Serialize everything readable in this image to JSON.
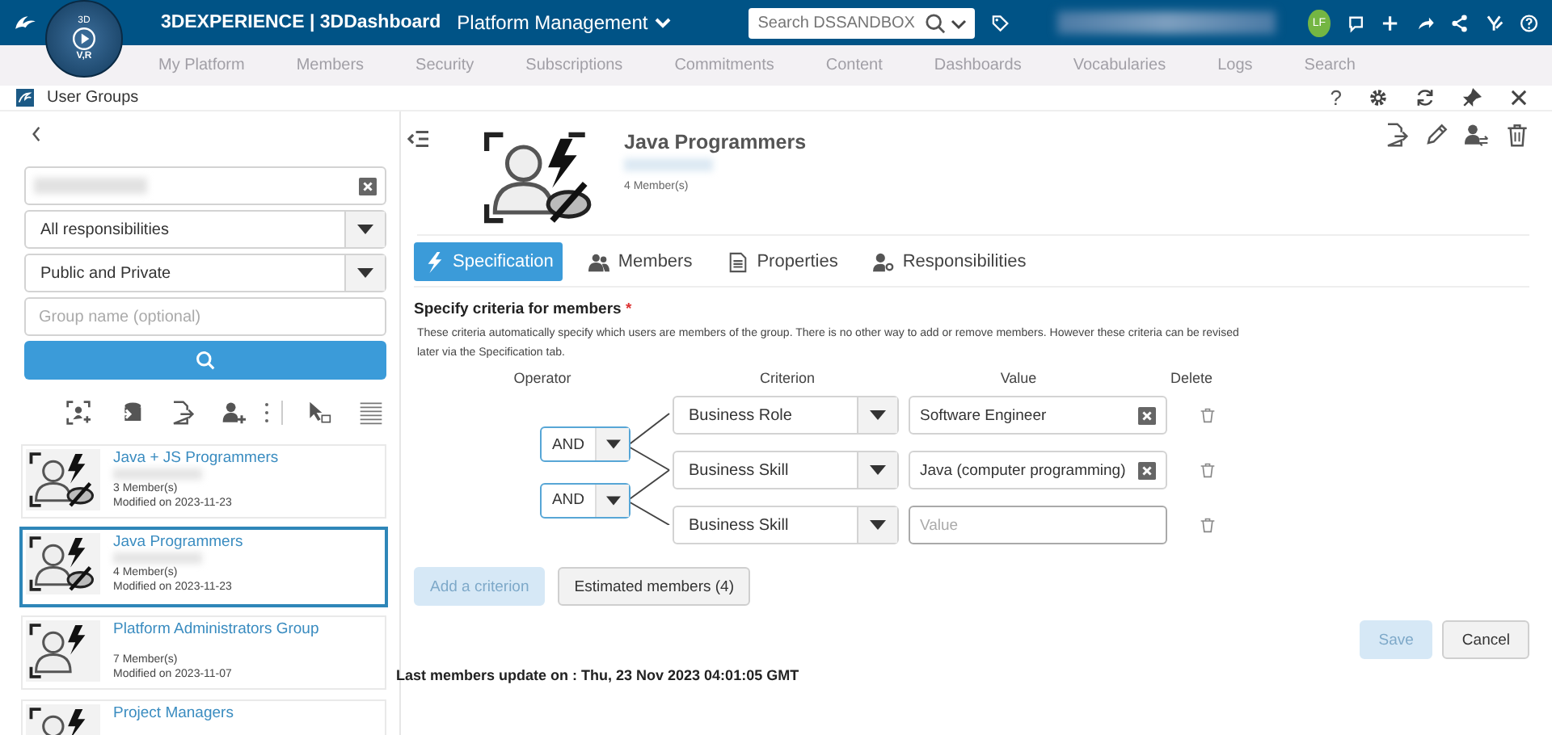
{
  "top_bar": {
    "brand": "3DEXPERIENCE | 3DDashboard",
    "dashboard": "Platform Management",
    "search": {
      "placeholder": "Search DSSANDBOX"
    },
    "compass": {
      "top": "3D",
      "bottom": "V,R"
    },
    "user_initials": "LF"
  },
  "nav_items": [
    "My Platform",
    "Members",
    "Security",
    "Subscriptions",
    "Commitments",
    "Content",
    "Dashboards",
    "Vocabularies",
    "Logs",
    "Search"
  ],
  "window": {
    "title": "User Groups",
    "help": "?"
  },
  "filters": {
    "selects": [
      "All responsibilities",
      "Public and Private"
    ],
    "group_name": {
      "placeholder": "Group name (optional)"
    }
  },
  "groups": [
    {
      "name": "Java + JS Programmers",
      "members": "3 Member(s)",
      "modified": "Modified on 2023-11-23",
      "private": true,
      "selected": false
    },
    {
      "name": "Java Programmers",
      "members": "4 Member(s)",
      "modified": "Modified on 2023-11-23",
      "private": true,
      "selected": true
    },
    {
      "name": "Platform Administrators Group",
      "members": "7 Member(s)",
      "modified": "Modified on 2023-11-07",
      "private": false,
      "selected": false
    },
    {
      "name": "Project Managers",
      "private": false,
      "selected": false
    }
  ],
  "detail": {
    "name": "Java Programmers",
    "members": "4 Member(s)",
    "private": true,
    "tabs": [
      {
        "label": "Specification",
        "kind": "bolt",
        "selected": true
      },
      {
        "label": "Members",
        "kind": "people",
        "selected": false
      },
      {
        "label": "Properties",
        "kind": "doc",
        "selected": false
      },
      {
        "label": "Responsibilities",
        "kind": "person-key",
        "selected": false
      }
    ],
    "criteria_title": "Specify criteria for members",
    "required_mark": "*",
    "description": "These criteria automatically specify which users are members of the group. There is no other way to add or remove members. However these criteria can be revised later via the Specification tab.",
    "columns": [
      "Operator",
      "Criterion",
      "Value",
      "Delete"
    ],
    "operators": [
      "AND",
      "AND"
    ],
    "rows": [
      {
        "criterion": "Business Role",
        "value": "Software Engineer"
      },
      {
        "criterion": "Business Skill",
        "value": "Java (computer programming)"
      },
      {
        "criterion": "Business Skill",
        "placeholder": "Value"
      }
    ],
    "add_button": {
      "label": "Add a criterion",
      "disabled": true
    },
    "estimate_button": {
      "label": "Estimated members (4)",
      "disabled": false
    },
    "save_button": {
      "label": "Save",
      "disabled": true
    },
    "cancel_button": {
      "label": "Cancel",
      "disabled": false
    },
    "last_update": "Last members update on : Thu, 23 Nov 2023 04:01:05 GMT"
  }
}
